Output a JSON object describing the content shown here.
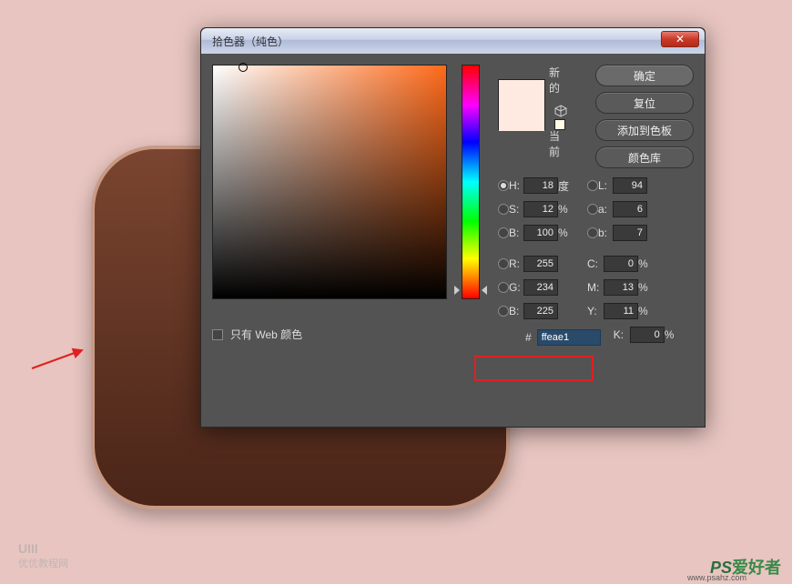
{
  "dialog": {
    "title": "拾色器（纯色）",
    "close_label": "✕",
    "web_only_label": "只有 Web 颜色",
    "buttons": {
      "ok": "确定",
      "reset": "复位",
      "add_swatch": "添加到色板",
      "color_lib": "颜色库"
    },
    "preview": {
      "new_label": "新的",
      "current_label": "当前"
    },
    "fields": {
      "H": {
        "label": "H:",
        "value": "18",
        "unit": "度"
      },
      "S": {
        "label": "S:",
        "value": "12",
        "unit": "%"
      },
      "B": {
        "label": "B:",
        "value": "100",
        "unit": "%"
      },
      "L": {
        "label": "L:",
        "value": "94"
      },
      "a": {
        "label": "a:",
        "value": "6"
      },
      "b": {
        "label": "b:",
        "value": "7"
      },
      "R": {
        "label": "R:",
        "value": "255"
      },
      "G": {
        "label": "G:",
        "value": "234"
      },
      "Bb": {
        "label": "B:",
        "value": "225"
      },
      "C": {
        "label": "C:",
        "value": "0",
        "unit": "%"
      },
      "M": {
        "label": "M:",
        "value": "13",
        "unit": "%"
      },
      "Y": {
        "label": "Y:",
        "value": "11",
        "unit": "%"
      },
      "K": {
        "label": "K:",
        "value": "0",
        "unit": "%"
      },
      "hex": {
        "label": "#",
        "value": "ffeae1"
      }
    }
  },
  "watermarks": {
    "left_line1": "UIII",
    "left_line2": "优优教程网",
    "right_brand": "PS",
    "right_rest": "爱好者",
    "right_sub": "www.psahz.com"
  }
}
